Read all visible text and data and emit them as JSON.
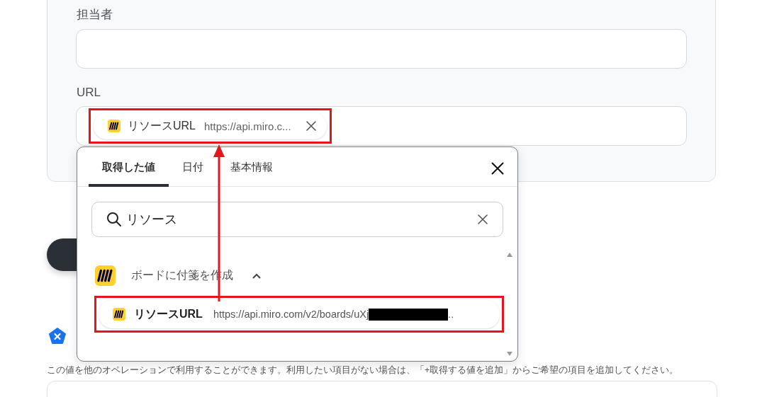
{
  "form": {
    "assignee": {
      "label": "担当者"
    },
    "url": {
      "label": "URL",
      "chip": {
        "label": "リソースURL",
        "value": "https://api.miro.c...",
        "highlighted": true
      }
    }
  },
  "popup": {
    "tabs": [
      {
        "label": "取得した値",
        "selected": true
      },
      {
        "label": "日付",
        "selected": false
      },
      {
        "label": "基本情報",
        "selected": false
      }
    ],
    "search": {
      "value": "リソース"
    },
    "groups": [
      {
        "title": "ボードに付箋を作成",
        "expanded": true,
        "items": [
          {
            "label": "リソースURL",
            "value": "https://api.miro.com/v2/boards/uXj",
            "suffix": "..",
            "redacted": true,
            "highlighted": true
          }
        ]
      }
    ]
  },
  "description": "この値を他のオペレーションで利用することができます。利用したい項目がない場合は、「+取得する値を追加」からご希望の項目を追加してください。"
}
